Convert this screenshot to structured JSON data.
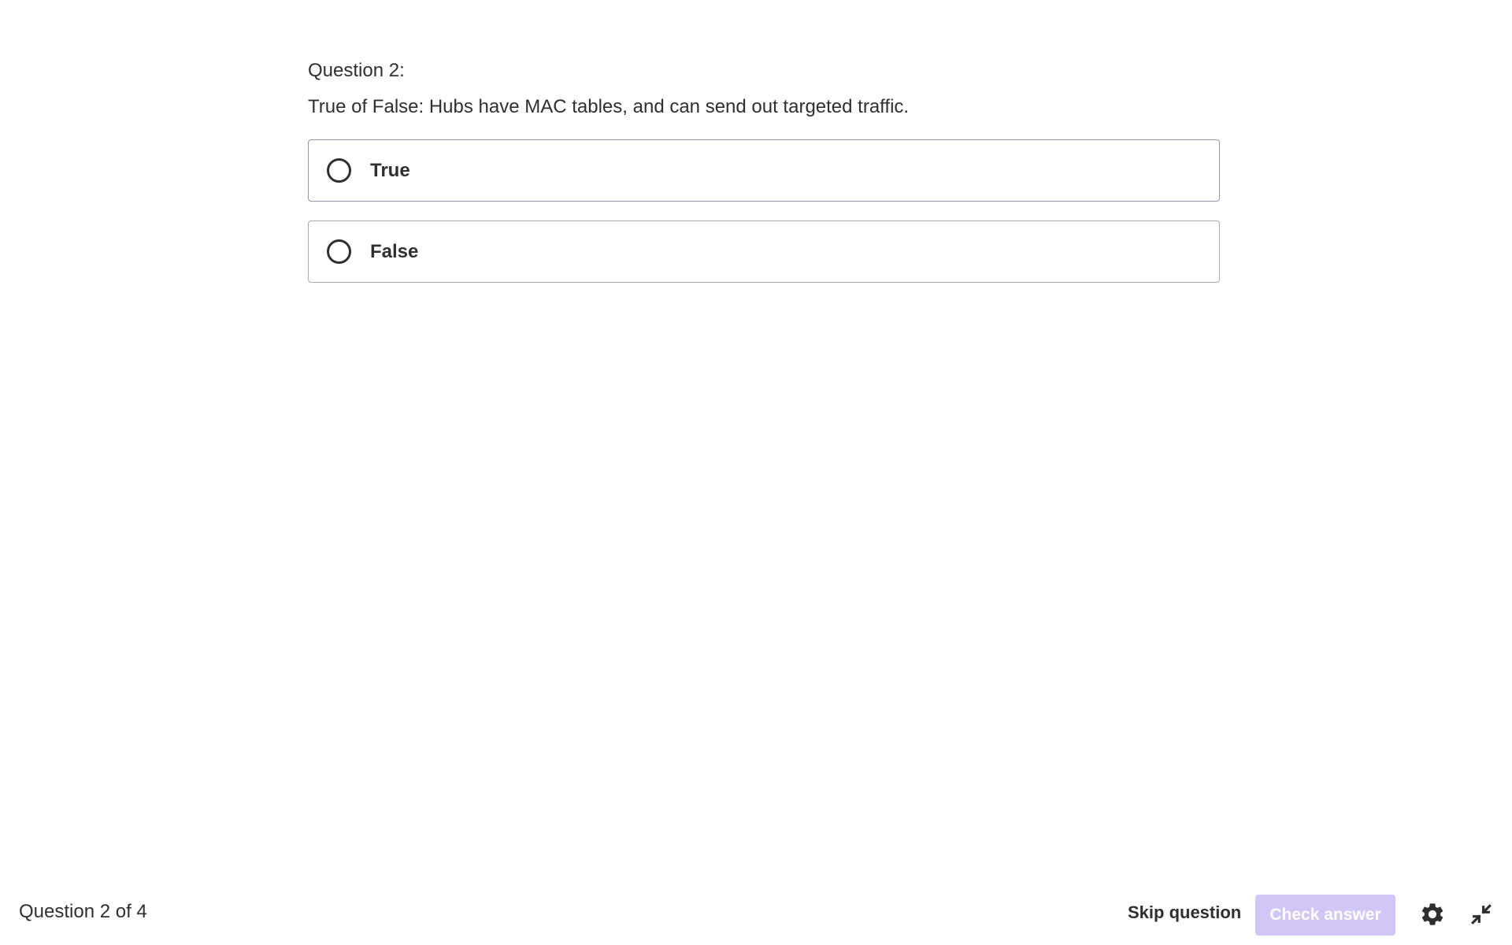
{
  "question": {
    "number_label": "Question 2:",
    "prompt": "True of False: Hubs have MAC tables, and can send out targeted traffic.",
    "options": [
      {
        "label": "True",
        "selected": false
      },
      {
        "label": "False",
        "selected": false
      }
    ]
  },
  "footer": {
    "progress_text": "Question 2 of 4",
    "skip_label": "Skip question",
    "check_label": "Check answer",
    "check_enabled": false
  },
  "icons": {
    "settings": "gear-icon",
    "collapse": "collapse-icon"
  },
  "colors": {
    "text": "#2d2f31",
    "check_button_disabled_bg": "#d1c6f5",
    "option_border": "#9194ac"
  }
}
